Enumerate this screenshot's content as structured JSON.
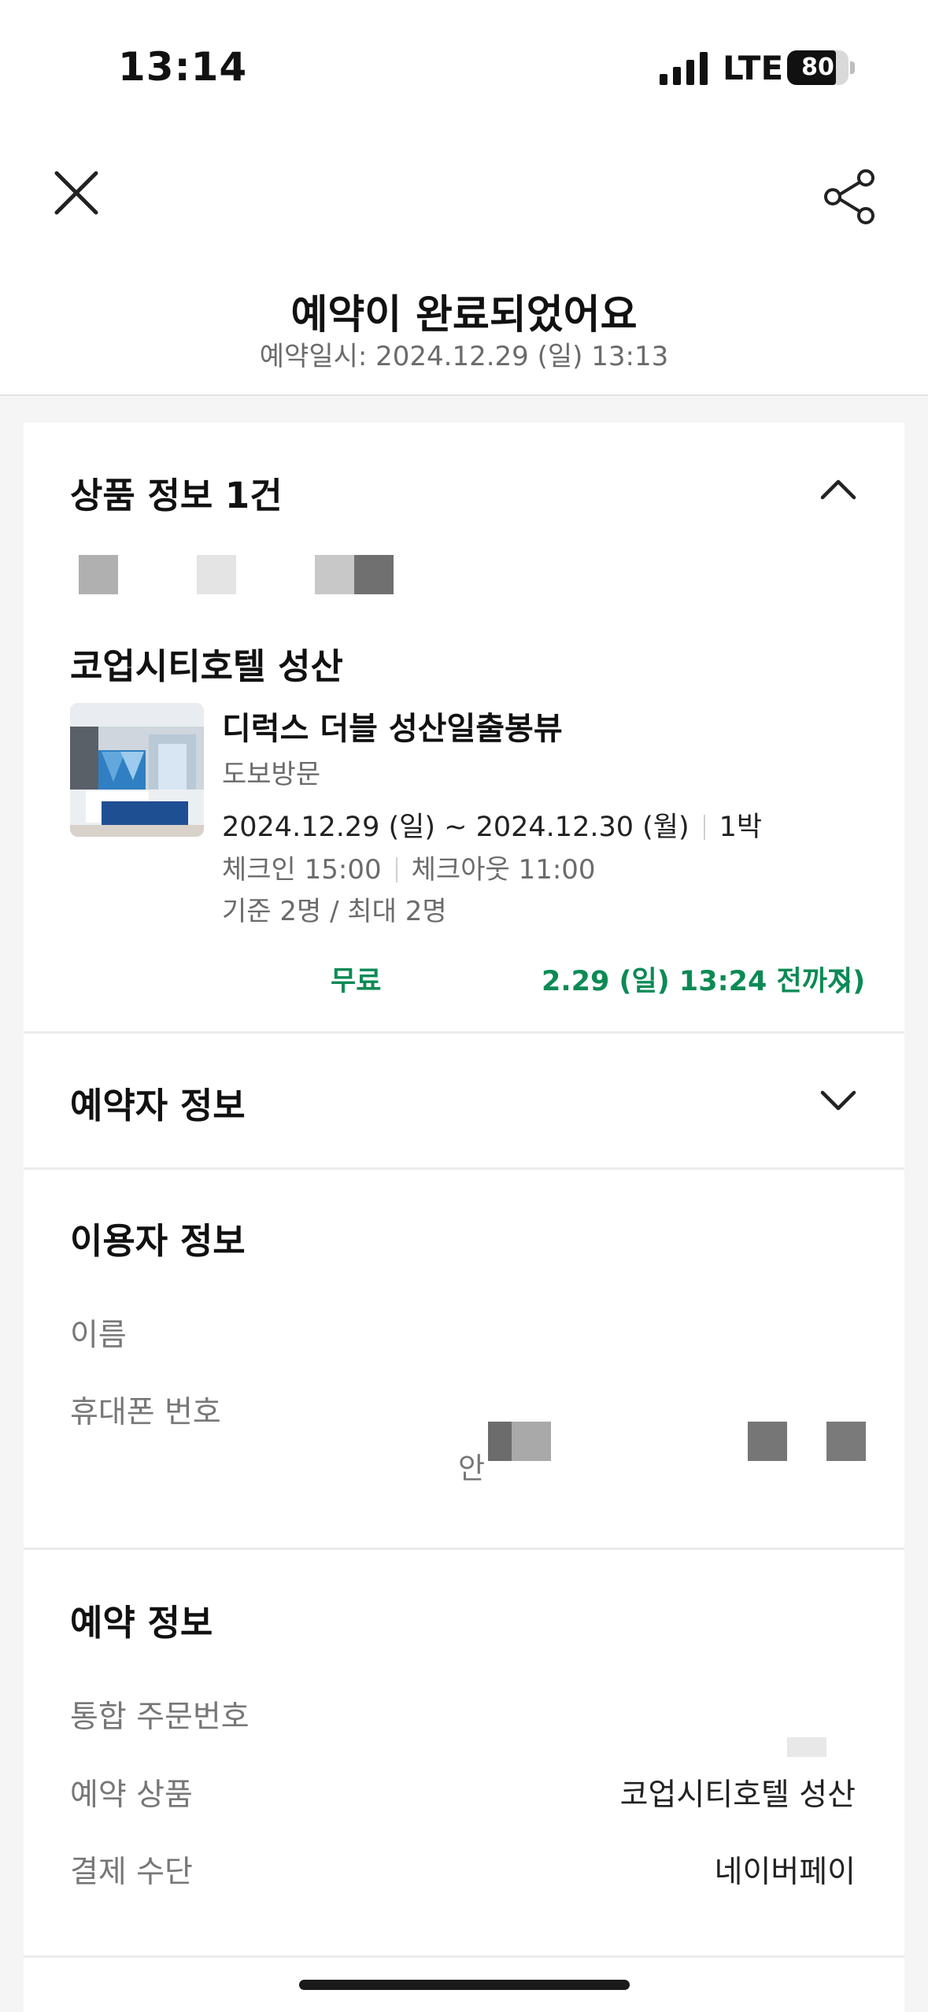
{
  "status_bar": {
    "time": "13:14",
    "network": "LTE",
    "battery": "80"
  },
  "header": {
    "title": "예약이 완료되었어요",
    "subtitle": "예약일시: 2024.12.29 (일) 13:13"
  },
  "product_section": {
    "title": "상품 정보 1건",
    "hotel_name": "코업시티호텔 성산",
    "room_name": "디럭스 더블 성산일출봉뷰",
    "visit_type": "도보방문",
    "stay_dates": "2024.12.29 (일) ~ 2024.12.30 (월)",
    "nights": "1박",
    "check_in": "체크인 15:00",
    "check_out": "체크아웃 11:00",
    "guests": "기준 2명 / 최대 2명",
    "cancel_left": "무료",
    "cancel_right": "2.29 (일) 13:24 전까지)"
  },
  "booker_section": {
    "title": "예약자 정보"
  },
  "user_section": {
    "title": "이용자 정보",
    "name_label": "이름",
    "phone_label": "휴대폰 번호",
    "phone_fragment": "안"
  },
  "reservation_section": {
    "title": "예약 정보",
    "order_label": "통합 주문번호",
    "product_label": "예약 상품",
    "product_value": "코업시티호텔 성산",
    "payment_label": "결제 수단",
    "payment_value": "네이버페이"
  },
  "colors": {
    "accent_green": "#0c8a55",
    "background": "#f5f5f5"
  }
}
